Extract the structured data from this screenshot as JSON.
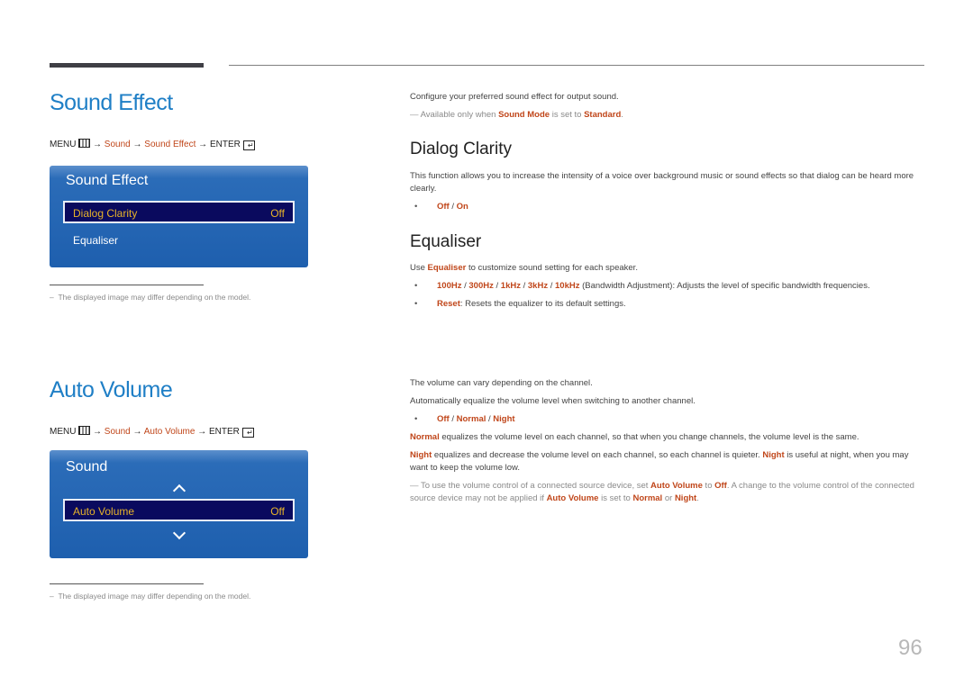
{
  "page_number": "96",
  "colors": {
    "heading_blue": "#1f7fc6",
    "highlight_orange": "#c0461a",
    "osd_blue": "#1e5fae",
    "osd_selected_bg": "#0a0a5e",
    "osd_selected_text": "#e6b22a"
  },
  "sound_effect": {
    "title": "Sound Effect",
    "menu_path": {
      "menu": "MENU",
      "arrow": "→",
      "step1": "Sound",
      "step2": "Sound Effect",
      "enter": "ENTER"
    },
    "osd": {
      "title": "Sound Effect",
      "selected_item": {
        "label": "Dialog Clarity",
        "value": "Off"
      },
      "items": [
        {
          "label": "Equaliser"
        }
      ]
    },
    "footnote": "The displayed image may differ depending on the model.",
    "intro": "Configure your preferred sound effect for output sound.",
    "note": {
      "prefix": "Available only when ",
      "term1": "Sound Mode",
      "mid": " is set to ",
      "term2": "Standard",
      "suffix": "."
    },
    "dialog_clarity": {
      "heading": "Dialog Clarity",
      "description": "This function allows you to increase the intensity of a voice over background music or sound effects so that dialog can be heard more clearly.",
      "options": [
        "Off",
        "On"
      ]
    },
    "equaliser": {
      "heading": "Equaliser",
      "intro": {
        "prefix": "Use ",
        "term": "Equaliser",
        "suffix": " to customize sound setting for each speaker."
      },
      "bands": [
        "100Hz",
        "300Hz",
        "1kHz",
        "3kHz",
        "10kHz"
      ],
      "bands_desc": " (Bandwidth Adjustment): Adjusts the level of specific bandwidth frequencies.",
      "reset": {
        "term": "Reset",
        "desc": ": Resets the equalizer to its default settings."
      }
    }
  },
  "auto_volume": {
    "title": "Auto Volume",
    "menu_path": {
      "menu": "MENU",
      "arrow": "→",
      "step1": "Sound",
      "step2": "Auto Volume",
      "enter": "ENTER"
    },
    "osd": {
      "title": "Sound",
      "selected_item": {
        "label": "Auto Volume",
        "value": "Off"
      }
    },
    "footnote": "The displayed image may differ depending on the model.",
    "line1": "The volume can vary depending on the channel.",
    "line2": "Automatically equalize the volume level when switching to another channel.",
    "options": [
      "Off",
      "Normal",
      "Night"
    ],
    "normal": {
      "term": "Normal",
      "desc": " equalizes the volume level on each channel, so that when you change channels, the volume level is the same."
    },
    "night": {
      "term": "Night",
      "desc1": " equalizes and decrease the volume level on each channel, so each channel is quieter. ",
      "term2": "Night",
      "desc2": " is useful at night, when you may want to keep the volume low."
    },
    "note": {
      "p1": "To use the volume control of a connected source device, set ",
      "t1": "Auto Volume",
      "p2": " to ",
      "t2": "Off",
      "p3": ". A change to the volume control of the connected source device may not be applied if ",
      "t3": "Auto Volume",
      "p4": " is set to ",
      "t4": "Normal",
      "p5": " or ",
      "t5": "Night",
      "p6": "."
    }
  }
}
